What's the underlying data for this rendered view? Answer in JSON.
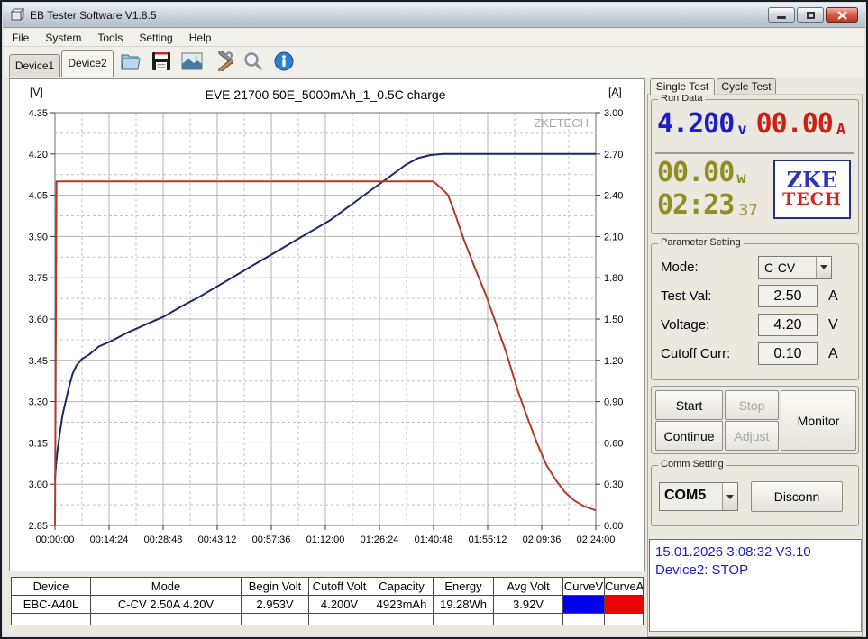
{
  "window": {
    "title": "EB Tester Software V1.8.5"
  },
  "menu": {
    "items": [
      "File",
      "System",
      "Tools",
      "Setting",
      "Help"
    ]
  },
  "device_tabs": {
    "tab1": "Device1",
    "tab2": "Device2",
    "active": "Device2"
  },
  "toolbar": {
    "icons": [
      "open-file-icon",
      "save-icon",
      "export-image-icon",
      "tools-icon",
      "zoom-icon",
      "info-icon"
    ]
  },
  "right_panel": {
    "tabs": {
      "tab1": "Single Test",
      "tab2": "Cycle Test",
      "active": "Single Test"
    },
    "run_data": {
      "group_label": "Run Data",
      "voltage": {
        "value": "4.200",
        "unit": "v",
        "color": "#1d1dc8"
      },
      "current": {
        "value": "00.00",
        "unit": "A",
        "color": "#cc2016"
      },
      "power": {
        "value": "00.00",
        "unit": "w",
        "color": "#8e8e22"
      },
      "time": {
        "value": "02:23",
        "seconds": "37",
        "color": "#8e8e22"
      },
      "logo": {
        "line1": "ZKE",
        "line2": "TECH",
        "color1": "#2b35b5",
        "color2": "#d42420"
      }
    },
    "parameter_setting": {
      "group_label": "Parameter Setting",
      "rows": [
        {
          "label": "Mode:",
          "value": "C-CV",
          "unit": ""
        },
        {
          "label": "Test Val:",
          "value": "2.50",
          "unit": "A"
        },
        {
          "label": "Voltage:",
          "value": "4.20",
          "unit": "V"
        },
        {
          "label": "Cutoff Curr:",
          "value": "0.10",
          "unit": "A"
        }
      ]
    },
    "buttons": {
      "start": "Start",
      "stop": "Stop",
      "monitor": "Monitor",
      "continue": "Continue",
      "adjust": "Adjust"
    },
    "comm_setting": {
      "group_label": "Comm Setting",
      "port": "COM5",
      "disconnect": "Disconn"
    },
    "status": {
      "line1": "15.01.2026 3:08:32  V3.10",
      "line2": "Device2: STOP",
      "text_color": "#1c1ccd"
    }
  },
  "table": {
    "columns": [
      "Device",
      "Mode",
      "Begin Volt",
      "Cutoff Volt",
      "Capacity",
      "Energy",
      "Avg Volt",
      "CurveV",
      "CurveA"
    ],
    "rows": [
      {
        "device": "EBC-A40L",
        "mode": "C-CV  2.50A  4.20V",
        "begin_volt": "2.953V",
        "cutoff_volt": "4.200V",
        "capacity": "4923mAh",
        "energy": "19.28Wh",
        "avg_volt": "3.92V",
        "curve_v_color": "#0000ee",
        "curve_a_color": "#ee0000"
      }
    ]
  },
  "chart_data": {
    "type": "line",
    "title": "EVE 21700 50E_5000mAh_1_0.5C charge",
    "watermark": "ZKETECH",
    "left_axis": {
      "label": "[V]",
      "min": 2.85,
      "max": 4.35,
      "ticks": [
        "4.35",
        "4.20",
        "4.05",
        "3.90",
        "3.75",
        "3.60",
        "3.45",
        "3.30",
        "3.15",
        "3.00",
        "2.85"
      ]
    },
    "right_axis": {
      "label": "[A]",
      "min": 0.0,
      "max": 3.0,
      "ticks": [
        "3.00",
        "2.70",
        "2.40",
        "2.10",
        "1.80",
        "1.50",
        "1.20",
        "0.90",
        "0.60",
        "0.30",
        "0.00"
      ]
    },
    "x_axis": {
      "min_seconds": 0,
      "max_seconds": 8640,
      "tick_labels": [
        "00:00:00",
        "00:14:24",
        "00:28:48",
        "00:43:12",
        "00:57:36",
        "01:12:00",
        "01:26:24",
        "01:40:48",
        "01:55:12",
        "02:09:36",
        "02:24:00"
      ]
    },
    "grid": true,
    "series": [
      {
        "name": "Voltage",
        "axis": "left",
        "color": "#1b2a63",
        "width": 2,
        "points": [
          [
            0,
            3.02
          ],
          [
            20,
            3.08
          ],
          [
            45,
            3.13
          ],
          [
            80,
            3.19
          ],
          [
            120,
            3.25
          ],
          [
            170,
            3.3
          ],
          [
            220,
            3.35
          ],
          [
            280,
            3.4
          ],
          [
            340,
            3.43
          ],
          [
            430,
            3.455
          ],
          [
            540,
            3.47
          ],
          [
            700,
            3.5
          ],
          [
            900,
            3.52
          ],
          [
            1150,
            3.55
          ],
          [
            1450,
            3.58
          ],
          [
            1750,
            3.61
          ],
          [
            2050,
            3.65
          ],
          [
            2300,
            3.68
          ],
          [
            2600,
            3.72
          ],
          [
            2900,
            3.76
          ],
          [
            3200,
            3.8
          ],
          [
            3500,
            3.84
          ],
          [
            3800,
            3.88
          ],
          [
            4100,
            3.92
          ],
          [
            4400,
            3.96
          ],
          [
            4700,
            4.01
          ],
          [
            5000,
            4.06
          ],
          [
            5300,
            4.11
          ],
          [
            5600,
            4.16
          ],
          [
            5800,
            4.185
          ],
          [
            6000,
            4.196
          ],
          [
            6200,
            4.2
          ],
          [
            8640,
            4.2
          ]
        ]
      },
      {
        "name": "Current",
        "axis": "right",
        "color": "#b23b2a",
        "width": 2,
        "points": [
          [
            0,
            0.0
          ],
          [
            25,
            2.5
          ],
          [
            6050,
            2.5
          ],
          [
            6120,
            2.47
          ],
          [
            6220,
            2.43
          ],
          [
            6280,
            2.4
          ],
          [
            6380,
            2.28
          ],
          [
            6530,
            2.08
          ],
          [
            6700,
            1.88
          ],
          [
            6880,
            1.68
          ],
          [
            7050,
            1.46
          ],
          [
            7200,
            1.27
          ],
          [
            7400,
            0.97
          ],
          [
            7550,
            0.78
          ],
          [
            7700,
            0.6
          ],
          [
            7850,
            0.44
          ],
          [
            8000,
            0.33
          ],
          [
            8150,
            0.24
          ],
          [
            8300,
            0.18
          ],
          [
            8450,
            0.14
          ],
          [
            8640,
            0.11
          ]
        ]
      }
    ]
  }
}
